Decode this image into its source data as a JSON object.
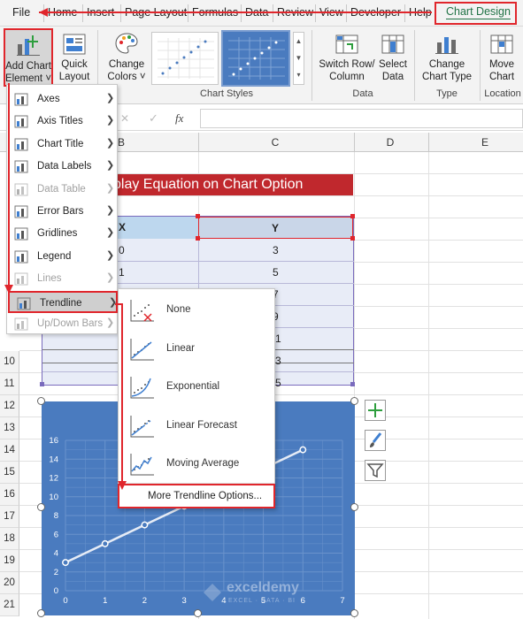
{
  "tabs": [
    "File",
    "Home",
    "Insert",
    "Page Layout",
    "Formulas",
    "Data",
    "Review",
    "View",
    "Developer",
    "Help",
    "Chart Design"
  ],
  "ribbon": {
    "add_chart_element": [
      "Add Chart",
      "Element ˅"
    ],
    "quick_layout": [
      "Quick",
      "Layout ˅"
    ],
    "change_colors": [
      "Change",
      "Colors ˅"
    ],
    "chart_styles_label": "Chart Styles",
    "switch_row_col": [
      "Switch Row/",
      "Column"
    ],
    "select_data": [
      "Select",
      "Data"
    ],
    "data_group_label": "Data",
    "change_chart_type": [
      "Change",
      "Chart Type"
    ],
    "type_group_label": "Type",
    "move_chart": [
      "Move",
      "Chart"
    ],
    "location_group_label": "Location"
  },
  "formula_bar": {
    "cancel": "✕",
    "enter": "✓",
    "fx": "fx"
  },
  "columns": [
    "B",
    "C",
    "D",
    "E"
  ],
  "rows": [
    "10",
    "11",
    "12",
    "13",
    "14",
    "15",
    "16",
    "17",
    "18",
    "19",
    "20",
    "21"
  ],
  "sheet": {
    "title": "splay Equation on Chart Option",
    "header_x": "X",
    "header_y": "Y",
    "x_values": [
      "0",
      "1",
      "2"
    ],
    "y_values": [
      "3",
      "5",
      "7",
      "9",
      "1",
      "3",
      "5"
    ]
  },
  "menu": {
    "items": [
      {
        "label": "Axes",
        "icon": "axes-icon",
        "disabled": false
      },
      {
        "label": "Axis Titles",
        "icon": "axis-titles-icon",
        "disabled": false
      },
      {
        "label": "Chart Title",
        "icon": "chart-title-icon",
        "disabled": false
      },
      {
        "label": "Data Labels",
        "icon": "data-labels-icon",
        "disabled": false
      },
      {
        "label": "Data Table",
        "icon": "data-table-icon",
        "disabled": true
      },
      {
        "label": "Error Bars",
        "icon": "error-bars-icon",
        "disabled": false
      },
      {
        "label": "Gridlines",
        "icon": "gridlines-icon",
        "disabled": false
      },
      {
        "label": "Legend",
        "icon": "legend-icon",
        "disabled": false
      },
      {
        "label": "Lines",
        "icon": "lines-icon",
        "disabled": true
      },
      {
        "label": "Trendline",
        "icon": "trendline-icon",
        "disabled": false
      },
      {
        "label": "Up/Down Bars",
        "icon": "up-down-bars-icon",
        "disabled": true
      }
    ]
  },
  "submenu": {
    "items": [
      "None",
      "Linear",
      "Exponential",
      "Linear Forecast",
      "Moving Average"
    ],
    "more": "More Trendline Options..."
  },
  "chart_data": {
    "type": "line",
    "x": [
      0,
      1,
      2,
      3,
      4,
      5,
      6
    ],
    "series": [
      {
        "values": [
          3,
          5,
          7,
          9,
          11,
          13,
          15
        ]
      }
    ],
    "xlim": [
      0,
      7
    ],
    "ylim": [
      0,
      16
    ],
    "xticks": [
      "0",
      "1",
      "2",
      "3",
      "4",
      "5",
      "6",
      "7"
    ],
    "yticks": [
      "0",
      "2",
      "4",
      "6",
      "8",
      "10",
      "12",
      "14",
      "16"
    ],
    "grid": true
  },
  "watermark": {
    "name": "exceldemy",
    "tagline": "EXCEL · DATA · BI"
  },
  "colors": {
    "accent_red": "#e0262c",
    "chart_bg": "#4a7bbf",
    "excel_green": "#217346",
    "title_red": "#c0282d",
    "header_blue": "#bdd7ee"
  }
}
